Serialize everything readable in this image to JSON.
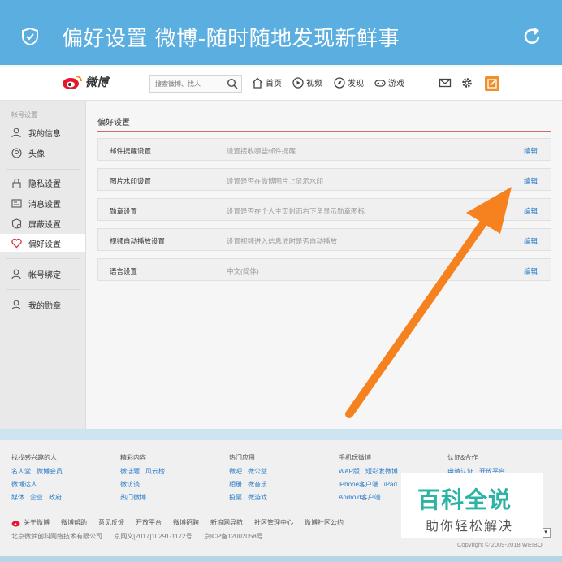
{
  "window": {
    "title": "偏好设置 微博-随时随地发现新鲜事"
  },
  "header": {
    "logo_text": "微博",
    "search_placeholder": "搜索微博、找人",
    "nav": [
      "首页",
      "视频",
      "发现",
      "游戏"
    ],
    "accent": "#f0902a"
  },
  "sidebar": {
    "group_label": "帐号设置",
    "items": [
      {
        "label": "我的信息",
        "icon": "person-icon"
      },
      {
        "label": "头像",
        "icon": "avatar-icon"
      },
      {
        "label": "隐私设置",
        "icon": "lock-icon"
      },
      {
        "label": "消息设置",
        "icon": "message-icon"
      },
      {
        "label": "屏蔽设置",
        "icon": "block-icon"
      },
      {
        "label": "偏好设置",
        "icon": "heart-icon",
        "active": true
      },
      {
        "label": "帐号绑定",
        "icon": "bind-icon"
      },
      {
        "label": "我的勋章",
        "icon": "medal-icon"
      }
    ]
  },
  "main": {
    "title": "偏好设置",
    "rows": [
      {
        "name": "邮件提醒设置",
        "desc": "设置接收哪些邮件提醒",
        "action": "编辑"
      },
      {
        "name": "图片水印设置",
        "desc": "设置是否在微博图片上显示水印",
        "action": "编辑"
      },
      {
        "name": "勋章设置",
        "desc": "设置是否在个人主页封面右下角显示勋章图标",
        "action": "编辑"
      },
      {
        "name": "视频自动播放设置",
        "desc": "设置视频进入信息流时是否自动播放",
        "action": "编辑"
      },
      {
        "name": "语言设置",
        "desc": "中文(简体)",
        "action": "编辑"
      }
    ]
  },
  "footer": {
    "columns": [
      {
        "heading": "找找感兴趣的人",
        "lines": [
          [
            "名人堂",
            "微博会员"
          ],
          [
            "微博达人"
          ],
          [
            "媒体",
            "企业",
            "政府"
          ]
        ]
      },
      {
        "heading": "精彩内容",
        "lines": [
          [
            "微话题",
            "风云榜"
          ],
          [
            "微访谈"
          ],
          [
            "热门微博"
          ]
        ]
      },
      {
        "heading": "热门应用",
        "lines": [
          [
            "微吧",
            "微公益"
          ],
          [
            "相册",
            "微音乐"
          ],
          [
            "投票",
            "微游戏"
          ]
        ]
      },
      {
        "heading": "手机玩微博",
        "lines": [
          [
            "WAP版",
            "短彩发微博"
          ],
          [
            "iPhone客户端",
            "iPad"
          ],
          [
            "Android客户端"
          ]
        ]
      },
      {
        "heading": "认证&合作",
        "lines": [
          [
            "申请认证",
            "开放平台"
          ]
        ]
      }
    ],
    "bottom_links": [
      "关于微博",
      "微博帮助",
      "意见反馈",
      "开放平台",
      "微博招聘",
      "新浪网导航",
      "社区管理中心",
      "微博社区公约"
    ],
    "company": [
      "北京微梦创科网络技术有限公司",
      "京网文[2017]10291-1172号",
      "京ICP备12002058号"
    ],
    "copyright": "Copyright © 2009-2018 WEIBO"
  },
  "watermark": {
    "title": "百科全说",
    "subtitle": "助你轻松解决"
  }
}
